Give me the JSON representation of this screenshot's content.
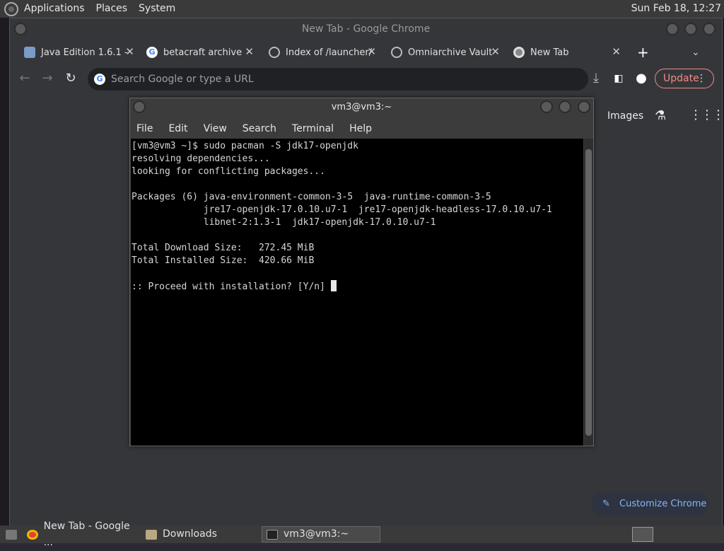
{
  "top_panel": {
    "menus": [
      "Applications",
      "Places",
      "System"
    ],
    "clock": "Sun Feb 18, 12:27"
  },
  "chrome": {
    "window_title": "New Tab - Google Chrome",
    "tabs": [
      {
        "label": "Java Edition 1.6.1 -",
        "icon": "java-edition-icon"
      },
      {
        "label": "betacraft archive",
        "icon": "google-icon"
      },
      {
        "label": "Index of /launcher/",
        "icon": "globe-icon"
      },
      {
        "label": "Omniarchive Vault",
        "icon": "globe-icon"
      },
      {
        "label": "New Tab",
        "icon": "chrome-icon"
      }
    ],
    "new_tab_symbol": "+",
    "omnibox_placeholder": "Search Google or type a URL",
    "update_label": "Update",
    "images_link": "Images",
    "customize_label": "Customize Chrome"
  },
  "terminal": {
    "title": "vm3@vm3:~",
    "menu": [
      "File",
      "Edit",
      "View",
      "Search",
      "Terminal",
      "Help"
    ],
    "lines": [
      "[vm3@vm3 ~]$ sudo pacman -S jdk17-openjdk",
      "resolving dependencies...",
      "looking for conflicting packages...",
      "",
      "Packages (6) java-environment-common-3-5  java-runtime-common-3-5",
      "             jre17-openjdk-17.0.10.u7-1  jre17-openjdk-headless-17.0.10.u7-1",
      "             libnet-2:1.3-1  jdk17-openjdk-17.0.10.u7-1",
      "",
      "Total Download Size:   272.45 MiB",
      "Total Installed Size:  420.66 MiB",
      "",
      ":: Proceed with installation? [Y/n] "
    ]
  },
  "taskbar": {
    "items": [
      {
        "label": "New Tab - Google ...",
        "icon": "chrome-icon"
      },
      {
        "label": "Downloads",
        "icon": "folder-icon"
      },
      {
        "label": "vm3@vm3:~",
        "icon": "terminal-icon"
      }
    ]
  }
}
